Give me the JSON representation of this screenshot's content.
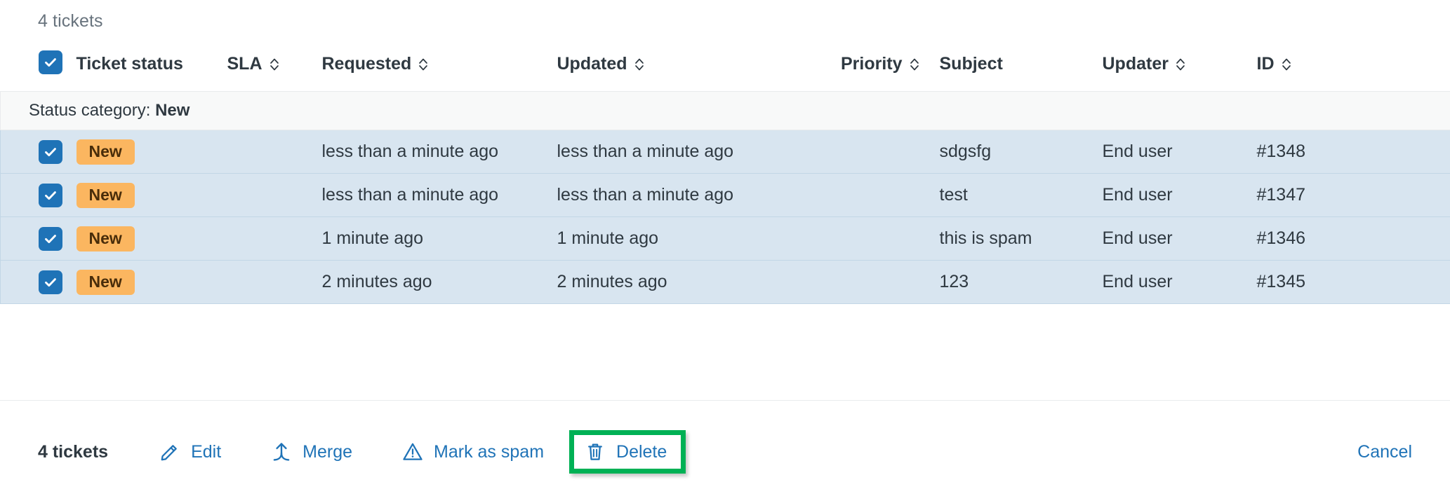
{
  "header": {
    "ticket_count_label": "4 tickets"
  },
  "table": {
    "select_all_checked": true,
    "columns": [
      {
        "key": "checkbox",
        "label": "",
        "sortable": false,
        "align": "left"
      },
      {
        "key": "status",
        "label": "Ticket status",
        "sortable": false,
        "align": "left"
      },
      {
        "key": "sla",
        "label": "SLA",
        "sortable": true,
        "align": "left"
      },
      {
        "key": "requested",
        "label": "Requested",
        "sortable": true,
        "align": "left"
      },
      {
        "key": "updated",
        "label": "Updated",
        "sortable": true,
        "align": "left"
      },
      {
        "key": "priority",
        "label": "Priority",
        "sortable": true,
        "align": "right"
      },
      {
        "key": "subject",
        "label": "Subject",
        "sortable": false,
        "align": "left"
      },
      {
        "key": "updater",
        "label": "Updater",
        "sortable": true,
        "align": "left"
      },
      {
        "key": "id",
        "label": "ID",
        "sortable": true,
        "align": "left"
      }
    ],
    "group": {
      "prefix": "Status category: ",
      "value": "New"
    },
    "rows": [
      {
        "checked": true,
        "status": "New",
        "sla": "",
        "requested": "less than a minute ago",
        "updated": "less than a minute ago",
        "priority": "",
        "subject": "sdgsfg",
        "updater": "End user",
        "id": "#1348"
      },
      {
        "checked": true,
        "status": "New",
        "sla": "",
        "requested": "less than a minute ago",
        "updated": "less than a minute ago",
        "priority": "",
        "subject": "test",
        "updater": "End user",
        "id": "#1347"
      },
      {
        "checked": true,
        "status": "New",
        "sla": "",
        "requested": "1 minute ago",
        "updated": "1 minute ago",
        "priority": "",
        "subject": "this is spam",
        "updater": "End user",
        "id": "#1346"
      },
      {
        "checked": true,
        "status": "New",
        "sla": "",
        "requested": "2 minutes ago",
        "updated": "2 minutes ago",
        "priority": "",
        "subject": "123",
        "updater": "End user",
        "id": "#1345"
      }
    ]
  },
  "footer": {
    "selection_count_label": "4 tickets",
    "actions": [
      {
        "label": "Edit",
        "icon": "pencil-icon"
      },
      {
        "label": "Merge",
        "icon": "merge-icon"
      },
      {
        "label": "Mark as spam",
        "icon": "warning-triangle-icon"
      },
      {
        "label": "Delete",
        "icon": "trash-icon",
        "highlighted": true
      }
    ],
    "cancel_label": "Cancel"
  },
  "colors": {
    "accent_blue": "#1f73b7",
    "row_selected_bg": "#d8e5f0",
    "row_border": "#c2d6e6",
    "group_bg": "#f8f9f9",
    "badge_new_bg": "#fbb660",
    "badge_new_text": "#492d0a",
    "highlight_green": "#00b155",
    "text_primary": "#2f3941",
    "text_muted": "#68737d"
  }
}
